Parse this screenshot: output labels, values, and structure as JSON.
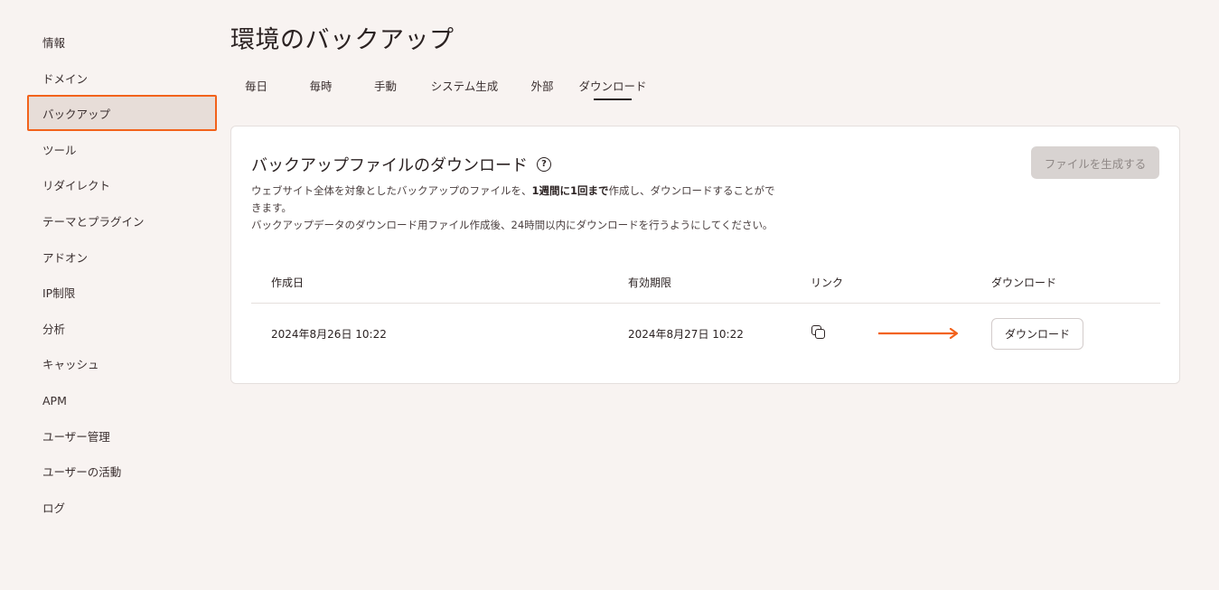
{
  "sidebar": {
    "items": [
      {
        "label": "情報"
      },
      {
        "label": "ドメイン"
      },
      {
        "label": "バックアップ",
        "active": true
      },
      {
        "label": "ツール"
      },
      {
        "label": "リダイレクト"
      },
      {
        "label": "テーマとプラグイン"
      },
      {
        "label": "アドオン"
      },
      {
        "label": "IP制限"
      },
      {
        "label": "分析"
      },
      {
        "label": "キャッシュ"
      },
      {
        "label": "APM"
      },
      {
        "label": "ユーザー管理"
      },
      {
        "label": "ユーザーの活動"
      },
      {
        "label": "ログ"
      }
    ]
  },
  "header": {
    "title": "環境のバックアップ"
  },
  "tabs": [
    {
      "label": "毎日"
    },
    {
      "label": "毎時"
    },
    {
      "label": "手動"
    },
    {
      "label": "システム生成"
    },
    {
      "label": "外部"
    },
    {
      "label": "ダウンロード",
      "active": true
    }
  ],
  "card": {
    "title": "バックアップファイルのダウンロード",
    "help_icon": "question-circle-icon",
    "generate_button": "ファイルを生成する",
    "desc_part1": "ウェブサイト全体を対象としたバックアップのファイルを、",
    "desc_bold": "1週間に1回まで",
    "desc_part2": "作成し、ダウンロードすることができます。",
    "desc_line2": "バックアップデータのダウンロード用ファイル作成後、24時間以内にダウンロードを行うようにしてください。"
  },
  "table": {
    "headers": [
      "作成日",
      "有効期限",
      "リンク",
      "ダウンロード"
    ],
    "rows": [
      {
        "created": "2024年8月26日 10:22",
        "expires": "2024年8月27日 10:22",
        "link_icon": "copy-icon",
        "download_label": "ダウンロード"
      }
    ]
  },
  "colors": {
    "accent": "#f2621b",
    "background": "#f8f3f1",
    "active_sidebar_bg": "#e7ddd8",
    "disabled_button_bg": "#d8d3d1"
  }
}
